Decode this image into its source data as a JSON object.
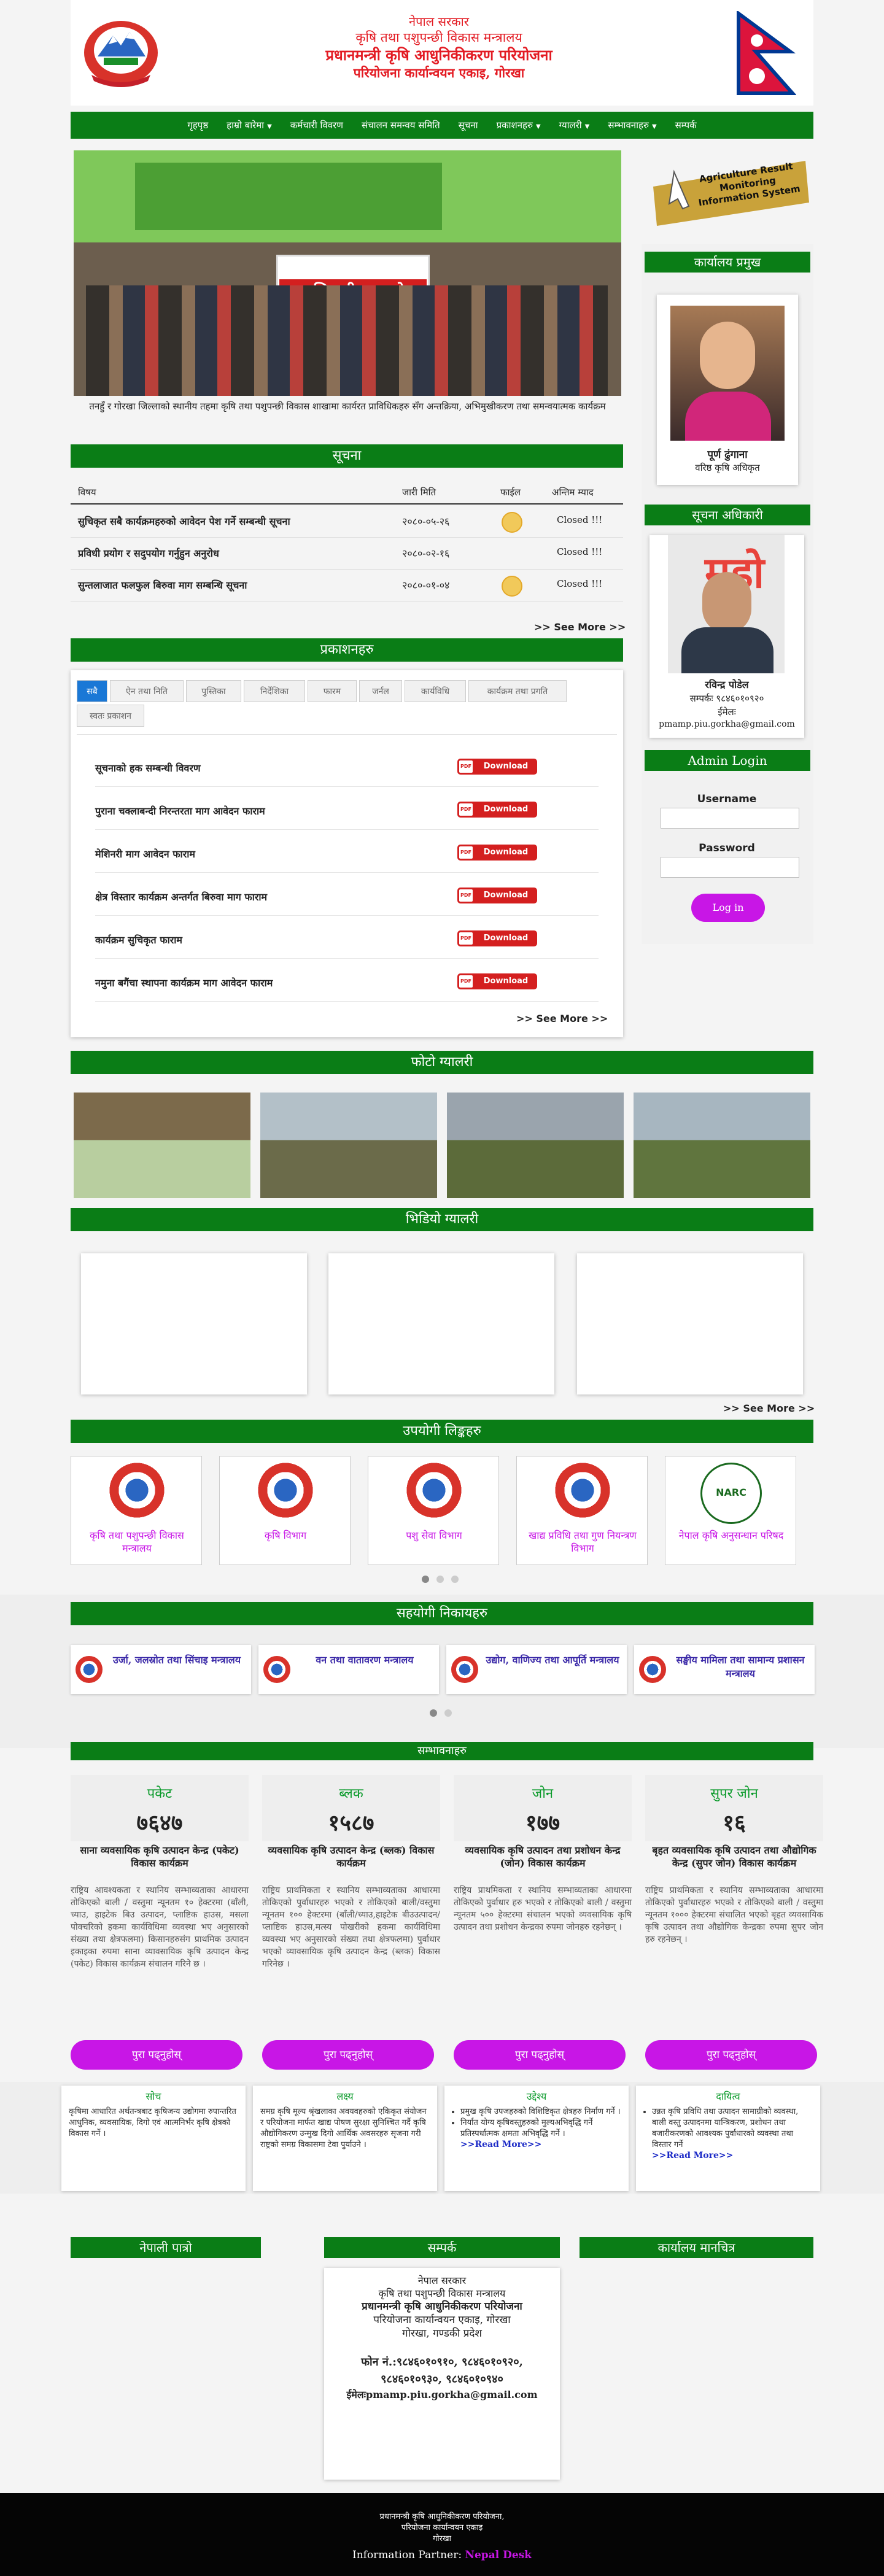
{
  "header": {
    "lines": [
      "नेपाल सरकार",
      "कृषि तथा पशुपन्छी विकास मन्त्रालय",
      "प्रधानमन्त्री कृषि आधुनिकीकरण परियोजना",
      "परियोजना कार्यान्वयन एकाइ, गोरखा"
    ],
    "emblem_alt": "नेपाल सरकार",
    "flag_alt": "नेपाल"
  },
  "nav": [
    {
      "label": "गृहपृष्ठ",
      "dropdown": false
    },
    {
      "label": "हाम्रो बारेमा",
      "dropdown": true
    },
    {
      "label": "कर्मचारी विवरण",
      "dropdown": false
    },
    {
      "label": "संचालन समन्वय समिति",
      "dropdown": false
    },
    {
      "label": "सूचना",
      "dropdown": false
    },
    {
      "label": "प्रकाशनहरु",
      "dropdown": true
    },
    {
      "label": "ग्यालरी",
      "dropdown": true
    },
    {
      "label": "सम्भावनाहरु",
      "dropdown": true
    },
    {
      "label": "सम्पर्क",
      "dropdown": false
    }
  ],
  "hero": {
    "banner_text": "अभिमुखीकरण गो",
    "caption": "तनहुँ र गोरखा जिल्लाको स्थानीय तहमा कृषि तथा पशुपन्छी विकास शाखामा कार्यरत प्राविधिकहरु सँग अन्तक्रिया, अभिमुखीकरण तथा समन्वयात्मक कार्यक्रम"
  },
  "arms": {
    "lines": [
      "Agriculture Result",
      "Monitoring",
      "Information System"
    ]
  },
  "office_head": {
    "title": "कार्यालय प्रमुख",
    "name": "पूर्ण ढुंगाना",
    "designation": "वरिष्ठ कृषि अधिकृत"
  },
  "info_officer": {
    "title": "सूचना अधिकारी",
    "poster_text": "महो",
    "name": "रविन्द्र पाेडेल",
    "phone": "सम्पर्कः ९८४६०१०९२०",
    "email_label": "ईमेलः",
    "email": "pmamp.piu.gorkha@gmail.com"
  },
  "login": {
    "title": "Admin Login",
    "username_label": "Username",
    "password_label": "Password",
    "button": "Log in"
  },
  "notices": {
    "title": "सूचना",
    "headers": [
      "विषय",
      "जारी मिति",
      "फाईल",
      "अन्तिम म्याद"
    ],
    "rows": [
      {
        "subject": "सुचिकृत सबै कार्यक्रमहरुको आवेदन पेश गर्ने सम्बन्धी सूचना",
        "date": "२०८०-०५-२६",
        "file": true,
        "deadline": "Closed !!!"
      },
      {
        "subject": "प्रविधी प्रयोग र सदुपयोग गर्नुहुन अनुरोध",
        "date": "२०८०-०२-१६",
        "file": false,
        "deadline": "Closed !!!"
      },
      {
        "subject": "सुन्तलाजात फलफुल बिरुवा माग सम्बन्धि सूचना",
        "date": "२०८०-०१-०४",
        "file": true,
        "deadline": "Closed !!!"
      }
    ],
    "see_more": ">> See More >>"
  },
  "publications": {
    "title": "प्रकाशनहरु",
    "tabs": [
      "सबै",
      "ऐन तथा निति",
      "पुस्तिका",
      "निर्देशिका",
      "फारम",
      "जर्नल",
      "कार्यविधि",
      "कार्यक्रम तथा प्रगति",
      "स्वतः प्रकाशन"
    ],
    "items": [
      "सूचनाको हक सम्बन्धी विवरण",
      "पुराना चक्लाबन्दी निरन्तरता माग आवेदन फाराम",
      "मेशिनरी माग आवेदन फाराम",
      "क्षेत्र विस्तार कार्यक्रम अन्तर्गत बिरुवा माग फाराम",
      "कार्यक्रम सुचिकृत फाराम",
      "नमुना बगैंचा स्थापना कार्यक्रम माग आवेदन फाराम"
    ],
    "download_label": "Download",
    "see_more": ">> See More >>"
  },
  "photo_gallery": {
    "title": "फोटो ग्यालरी"
  },
  "video_gallery": {
    "title": "भिडियो ग्यालरी",
    "see_more": ">> See More >>"
  },
  "useful_links": {
    "title": "उपयोगी लिङ्कहरु",
    "items": [
      "कृषि तथा पशुपन्छी विकास मन्त्रालय",
      "कृषि विभाग",
      "पशु सेवा विभाग",
      "खाद्य प्रविधि तथा गुण नियन्त्रण विभाग",
      "नेपाल कृषि अनुसन्धान परिषद"
    ],
    "narc_label": "NARC"
  },
  "partners": {
    "title": "सहयोगी निकायहरु",
    "items": [
      "उर्जा, जलस्रोत तथा सिंचाइ मन्त्रालय",
      "वन तथा वातावरण मन्त्रालय",
      "उद्योग, वाणिज्य तथा आपूर्ति मन्त्रालय",
      "सङ्घीय मामिला तथा सामान्य प्रशासन मन्त्रालय"
    ]
  },
  "possibilities": {
    "title": "सम्भावनाहरु",
    "items": [
      {
        "level": "पकेट",
        "count": "७६४७",
        "heading": "साना व्यवसायिक कृषि उत्पादन केन्द्र (पकेट) विकास कार्यक्रम",
        "body": "राष्ट्रिय आवश्यकता र स्थानिय सम्भाव्यताका आधारमा तोकिएको बाली / वस्तुमा न्यूनतम १० हेक्टरमा (बाँली, च्याउ, हाइटेक बिउ उत्पादन, प्लाष्टिक हाउस, मसला पोक्चरिको हकमा कार्यविधिमा व्यवस्था भए अनुसारको संख्या तथा क्षेत्रफलमा) किसानहरुसंग प्राथमिक उत्पादन इकाइका रुपमा साना व्यावसायिक कृषि उत्पादन केन्द्र (पकेट) विकास कार्यक्रम संचालन गरिने छ ।",
        "button": "पुरा पढ्नुहोस्"
      },
      {
        "level": "ब्लक",
        "count": "१५८७",
        "heading": "व्यवसायिक कृषि उत्पादन केन्द्र (ब्लक) विकास कार्यक्रम",
        "body": "राष्ट्रिय प्राथमिकता र स्थानिय सम्भाव्यताका आधारमा तोकिएको पुर्वाधारहरु भएको र तोकिएको बाली/वस्तुमा न्यूनतम १०० हेक्टरमा (बाँली/च्याउ,हाइटेक बीउउत्पादन/ प्लाष्टिक हाउस,मत्स्य पोखरीको हकमा कार्यविधिमा व्यवस्था भए अनुसारको संख्या तथा क्षेत्रफलमा) पुर्वाधार भएको व्यावसायिक कृषि उत्पादन केन्द्र (ब्लक) विकास गरिनेछ ।",
        "button": "पुरा पढ्नुहोस्"
      },
      {
        "level": "जोन",
        "count": "१७७",
        "heading": "व्यवसायिक कृषि उत्पादन तथा प्रशोधन केन्द्र (जोन) विकास कार्यक्रम",
        "body": "राष्ट्रिय प्राथमिकता र स्थानिय सम्भाव्यताका आधारमा तोकिएको पुर्वाधार हरु भएको र तोकिएको बाली / वस्तुमा न्यूनतम ५०० हेक्टरमा संचालन भएको व्यवसायिक कृषि उत्पादन तथा प्रशोधन केन्द्रका रुपमा जोनहरु रहनेछन् ।",
        "button": "पुरा पढ्नुहोस्"
      },
      {
        "level": "सुपर जोन",
        "count": "१६",
        "heading": "बृहत व्यवसायिक कृषि उत्पादन तथा औद्योगिक केन्द्र (सुपर जोन) विकास कार्यक्रम",
        "body": "राष्ट्रिय प्राथमिकता र स्थानिय सम्भाव्यताका आधारमा तोकिएको पुर्वाधारहरु भएको र तोकिएको बाली / वस्तुमा न्यूनतम १००० हेक्टरमा संचालित भएको बृहत व्यवसायिक कृषि उत्पादन तथा औद्योगिक केन्द्रका रुपमा सुपर जोन हरु रहनेछन् ।",
        "button": "पुरा पढ्नुहोस्"
      }
    ]
  },
  "vision": [
    {
      "title": "सोच",
      "body": "कृषिमा आधारित अर्थतन्त्रबाट कृषिजन्य उद्योगमा रुपान्तरित आधुनिक, व्यवसायिक, दिगो एवं आत्मनिर्भर कृषि क्षेत्रको विकास गर्ने ।",
      "list": false,
      "more": ""
    },
    {
      "title": "लक्ष्य",
      "body": "समग्र कृषि मूल्य श्रृंखलाका अवयवहरुको एकिकृत संयोजन र परियोजना मार्फत खाद्य पोषण सुरक्षा सुनिश्चित गर्दै कृषि औद्योगिकरण उन्मुख दिगो आर्थिक अवसरहरु सृजना गरी राष्ट्रको समग्र विकासमा टेवा पुर्याउने ।",
      "list": false,
      "more": ""
    },
    {
      "title": "उद्देश्य",
      "items": [
        "प्रमुख कृषि उपजहरुको विशिष्टिकृत क्षेत्रहरु निर्माण गर्ने ।",
        "निर्यात योग्य कृषिवस्तुहरुको मुल्यअभिवृद्धि गर्ने प्रतिस्पर्धात्मक क्षमता अभिवृद्धि गर्ने ।"
      ],
      "list": true,
      "more": ">>Read More>>"
    },
    {
      "title": "दायित्व",
      "items": [
        "उन्नत कृषि प्रविधि तथा उत्पादन सामाग्रीको व्यवस्था, बाली वस्तु उत्पादनमा यान्त्रिकरण, प्रशोधन तथा बजारीकरणको आवश्यक पुर्वाधारको व्यवस्था तथा विस्तार गर्ने"
      ],
      "list": true,
      "more": ">>Read More>>"
    }
  ],
  "footer_cols": {
    "patro": "नेपाली पात्रो",
    "contact": "सम्पर्क",
    "map": "कार्यालय मानचित्र"
  },
  "contact": {
    "lines": [
      "नेपाल सरकार",
      "कृषि तथा पशुपन्छी विकास मन्त्रालय"
    ],
    "bold_line": "प्रधानमन्त्री कृषि आधुनिकीकरण परियोजना",
    "address_lines": [
      "परियोजना कार्यान्वयन एकाइ, गोरखा",
      "गोरखा, गण्डकी प्रदेश"
    ],
    "phone": "फोन नं.:९८४६०१०९१०, ९८४६०१०९२०, ९८४६०१०९३०, ९८४६०१०९४०",
    "email": "ईमेलःpmamp.piu.gorkha@gmail.com"
  },
  "bottom": {
    "lines": [
      "प्रधानमन्त्री कृषि आधुनिकीकरण परियोजना,",
      "परियोजना कार्यान्वयन एकाइ",
      "गोरखा"
    ],
    "partner_label": "Information Partner: ",
    "partner_name": "Nepal Desk"
  },
  "colors": {
    "green": "#0a7d16",
    "purple": "#c816e6",
    "red": "#d41f1f",
    "header_red": "#e31b23"
  }
}
